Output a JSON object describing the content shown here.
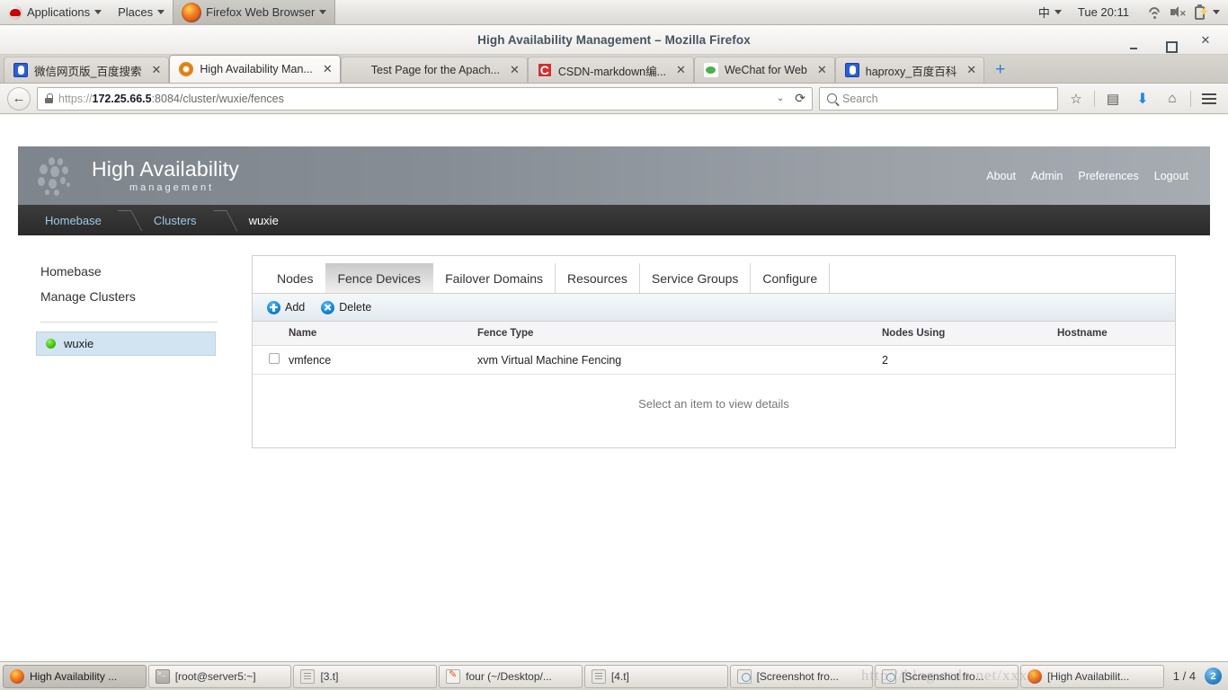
{
  "desktop": {
    "panel": {
      "applications": "Applications",
      "places": "Places",
      "active_app": "Firefox Web Browser",
      "input_method": "中",
      "clock": "Tue 20:11"
    }
  },
  "browser": {
    "window_title": "High Availability Management – Mozilla Firefox",
    "window_buttons": {
      "minimize": "–",
      "maximize": "▫",
      "close": "✕"
    },
    "tabs": [
      {
        "label": "微信网页版_百度搜索",
        "favicon": "baidu-icon",
        "active": false
      },
      {
        "label": "High Availability Man...",
        "favicon": "gear-icon",
        "active": true
      },
      {
        "label": "Test Page for the Apach...",
        "favicon": "blank-icon",
        "active": false
      },
      {
        "label": "CSDN-markdown编...",
        "favicon": "csdn-icon",
        "active": false
      },
      {
        "label": "WeChat for Web",
        "favicon": "wechat-icon",
        "active": false
      },
      {
        "label": "haproxy_百度百科",
        "favicon": "baidu-icon",
        "active": false
      }
    ],
    "new_tab_label": "+",
    "url": {
      "scheme": "https://",
      "host": "172.25.66.5",
      "rest": ":8084/cluster/wuxie/fences",
      "full": "https://172.25.66.5:8084/cluster/wuxie/fences"
    },
    "search_placeholder": "Search",
    "back_label": "←",
    "reload_label": "⟳"
  },
  "app": {
    "brand_title": "High Availability",
    "brand_subtitle": "management",
    "header_links": [
      "About",
      "Admin",
      "Preferences",
      "Logout"
    ],
    "breadcrumb": [
      {
        "label": "Homebase",
        "current": false
      },
      {
        "label": "Clusters",
        "current": false
      },
      {
        "label": "wuxie",
        "current": true
      }
    ],
    "sidebar": {
      "links": [
        "Homebase",
        "Manage Clusters"
      ],
      "clusters": [
        {
          "name": "wuxie",
          "status": "running",
          "status_color": "#44c410",
          "selected": true
        }
      ]
    },
    "tabs": [
      {
        "label": "Nodes",
        "selected": false
      },
      {
        "label": "Fence Devices",
        "selected": true
      },
      {
        "label": "Failover Domains",
        "selected": false
      },
      {
        "label": "Resources",
        "selected": false
      },
      {
        "label": "Service Groups",
        "selected": false
      },
      {
        "label": "Configure",
        "selected": false
      }
    ],
    "toolbar": {
      "add_label": "Add",
      "delete_label": "Delete"
    },
    "table": {
      "columns": [
        "",
        "Name",
        "Fence Type",
        "Nodes Using",
        "Hostname"
      ],
      "rows": [
        {
          "checked": false,
          "name": "vmfence",
          "fence_type": "xvm Virtual Machine Fencing",
          "nodes_using": "2",
          "hostname": ""
        }
      ]
    },
    "detail_placeholder": "Select an item to view details",
    "accent_color": "#1583cc"
  },
  "taskbar": {
    "items": [
      {
        "label": "High Availability ...",
        "icon": "firefox-icon",
        "active": true
      },
      {
        "label": "[root@server5:~]",
        "icon": "terminal-icon",
        "active": false
      },
      {
        "label": "[3.t]",
        "icon": "document-icon",
        "active": false
      },
      {
        "label": "four (~/Desktop/...",
        "icon": "editor-icon",
        "active": false
      },
      {
        "label": "[4.t]",
        "icon": "document-icon",
        "active": false
      },
      {
        "label": "[Screenshot fro...",
        "icon": "screenshot-icon",
        "active": false
      },
      {
        "label": "[Screenshot fro...",
        "icon": "screenshot-icon",
        "active": false
      },
      {
        "label": "[High Availabilit...",
        "icon": "firefox-icon",
        "active": false
      }
    ],
    "workspace_count": "1 / 4",
    "workspace_badge": "2",
    "watermark": "http://blog.csdn.net/xxxx"
  }
}
